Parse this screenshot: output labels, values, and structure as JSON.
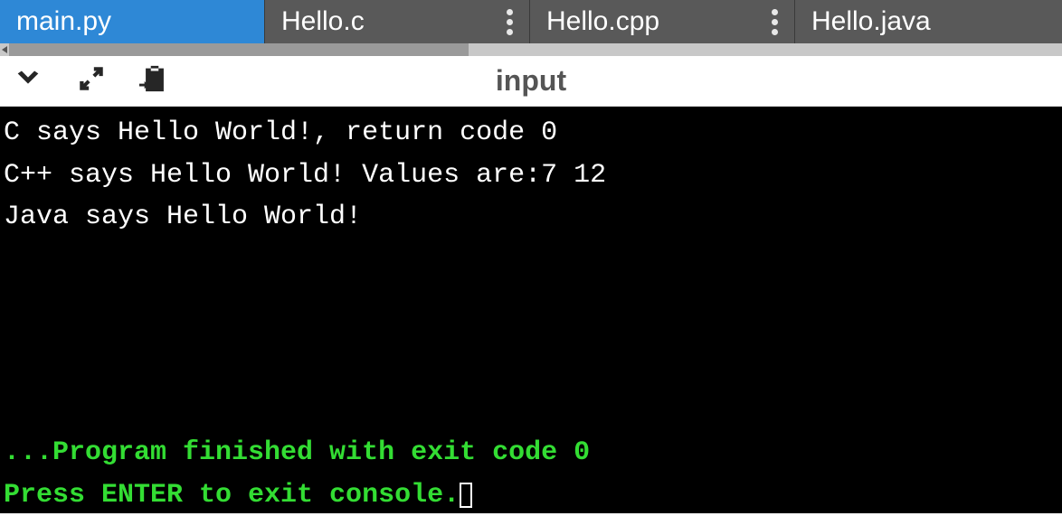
{
  "tabs": [
    {
      "label": "main.py",
      "active": true,
      "has_menu": false,
      "width_class": "tab-wide"
    },
    {
      "label": "Hello.c",
      "active": false,
      "has_menu": true,
      "width_class": "tab-wide"
    },
    {
      "label": "Hello.cpp",
      "active": false,
      "has_menu": true,
      "width_class": "tab-wide"
    },
    {
      "label": "Hello.java",
      "active": false,
      "has_menu": false,
      "width_class": ""
    }
  ],
  "toolbar": {
    "title": "input"
  },
  "console": {
    "output_lines": [
      "C says Hello World!, return code 0",
      "C++ says Hello World! Values are:7 12",
      "Java says Hello World!"
    ],
    "status_lines": [
      "...Program finished with exit code 0",
      "Press ENTER to exit console."
    ]
  }
}
